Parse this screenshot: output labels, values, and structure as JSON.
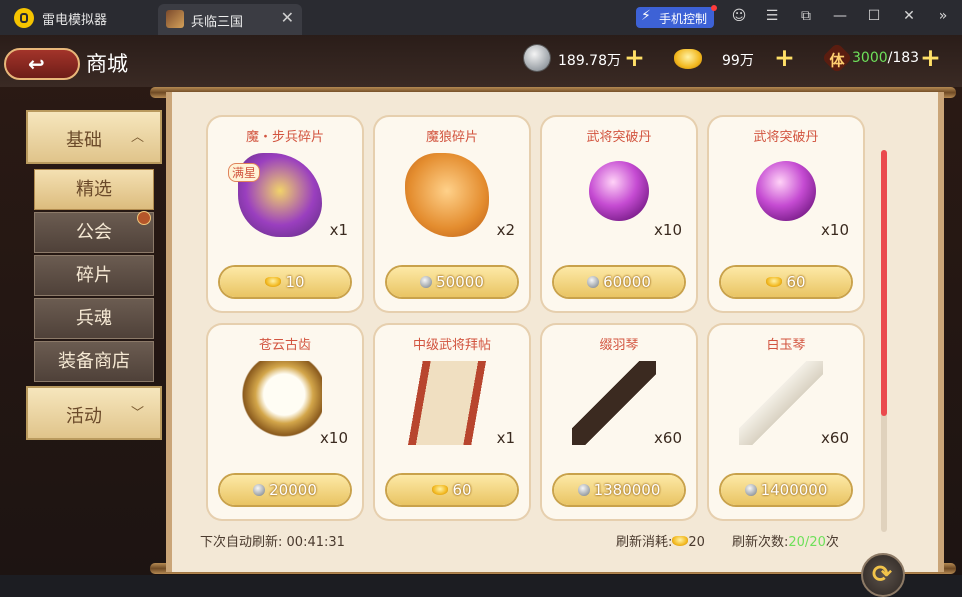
{
  "emulator": {
    "app_name": "雷电模拟器",
    "tab_title": "兵临三国",
    "tab_close": "✕",
    "phone_control_label": "手机控制",
    "icons": [
      "user-icon",
      "menu-icon",
      "window-mode-icon",
      "minimize-icon",
      "maximize-icon",
      "close-icon",
      "collapse-icon"
    ]
  },
  "header": {
    "title": "商城",
    "silver": "189.78万",
    "gold": "99万",
    "stamina_icon_text": "体",
    "stamina_current": "3000",
    "stamina_max": "/183"
  },
  "sidebar": {
    "base_label": "基础",
    "base_chevron": "︿",
    "sub_items": [
      "精选",
      "公会",
      "碎片",
      "兵魂",
      "装备商店"
    ],
    "event_label": "活动",
    "event_chevron": "﹀",
    "active_item": "精选"
  },
  "items": [
    {
      "name": "魔・步兵碎片",
      "qty": "x1",
      "badge": "满星",
      "currency": "gold",
      "price": "10"
    },
    {
      "name": "魔狼碎片",
      "qty": "x2",
      "badge": "",
      "currency": "silver",
      "price": "50000"
    },
    {
      "name": "武将突破丹",
      "qty": "x10",
      "badge": "",
      "currency": "silver",
      "price": "60000"
    },
    {
      "name": "武将突破丹",
      "qty": "x10",
      "badge": "",
      "currency": "gold",
      "price": "60"
    },
    {
      "name": "苍云古齿",
      "qty": "x10",
      "badge": "",
      "currency": "silver",
      "price": "20000"
    },
    {
      "name": "中级武将拜帖",
      "qty": "x1",
      "badge": "",
      "currency": "gold",
      "price": "60"
    },
    {
      "name": "缀羽琴",
      "qty": "x60",
      "badge": "",
      "currency": "silver",
      "price": "1380000"
    },
    {
      "name": "白玉琴",
      "qty": "x60",
      "badge": "",
      "currency": "silver",
      "price": "1400000"
    }
  ],
  "footer": {
    "auto_refresh_label": "下次自动刷新:",
    "auto_refresh_time": "00:41:31",
    "refresh_cost_label": "刷新消耗:",
    "refresh_cost": "20",
    "refresh_count_label": "刷新次数:",
    "refresh_count": "20/20",
    "refresh_count_suffix": "次"
  },
  "colors": {
    "accent_red": "#d2543f",
    "scroll_thumb": "#ea4a4e",
    "count_green": "#6ee05a",
    "phone_btn": "#3d62d6"
  }
}
